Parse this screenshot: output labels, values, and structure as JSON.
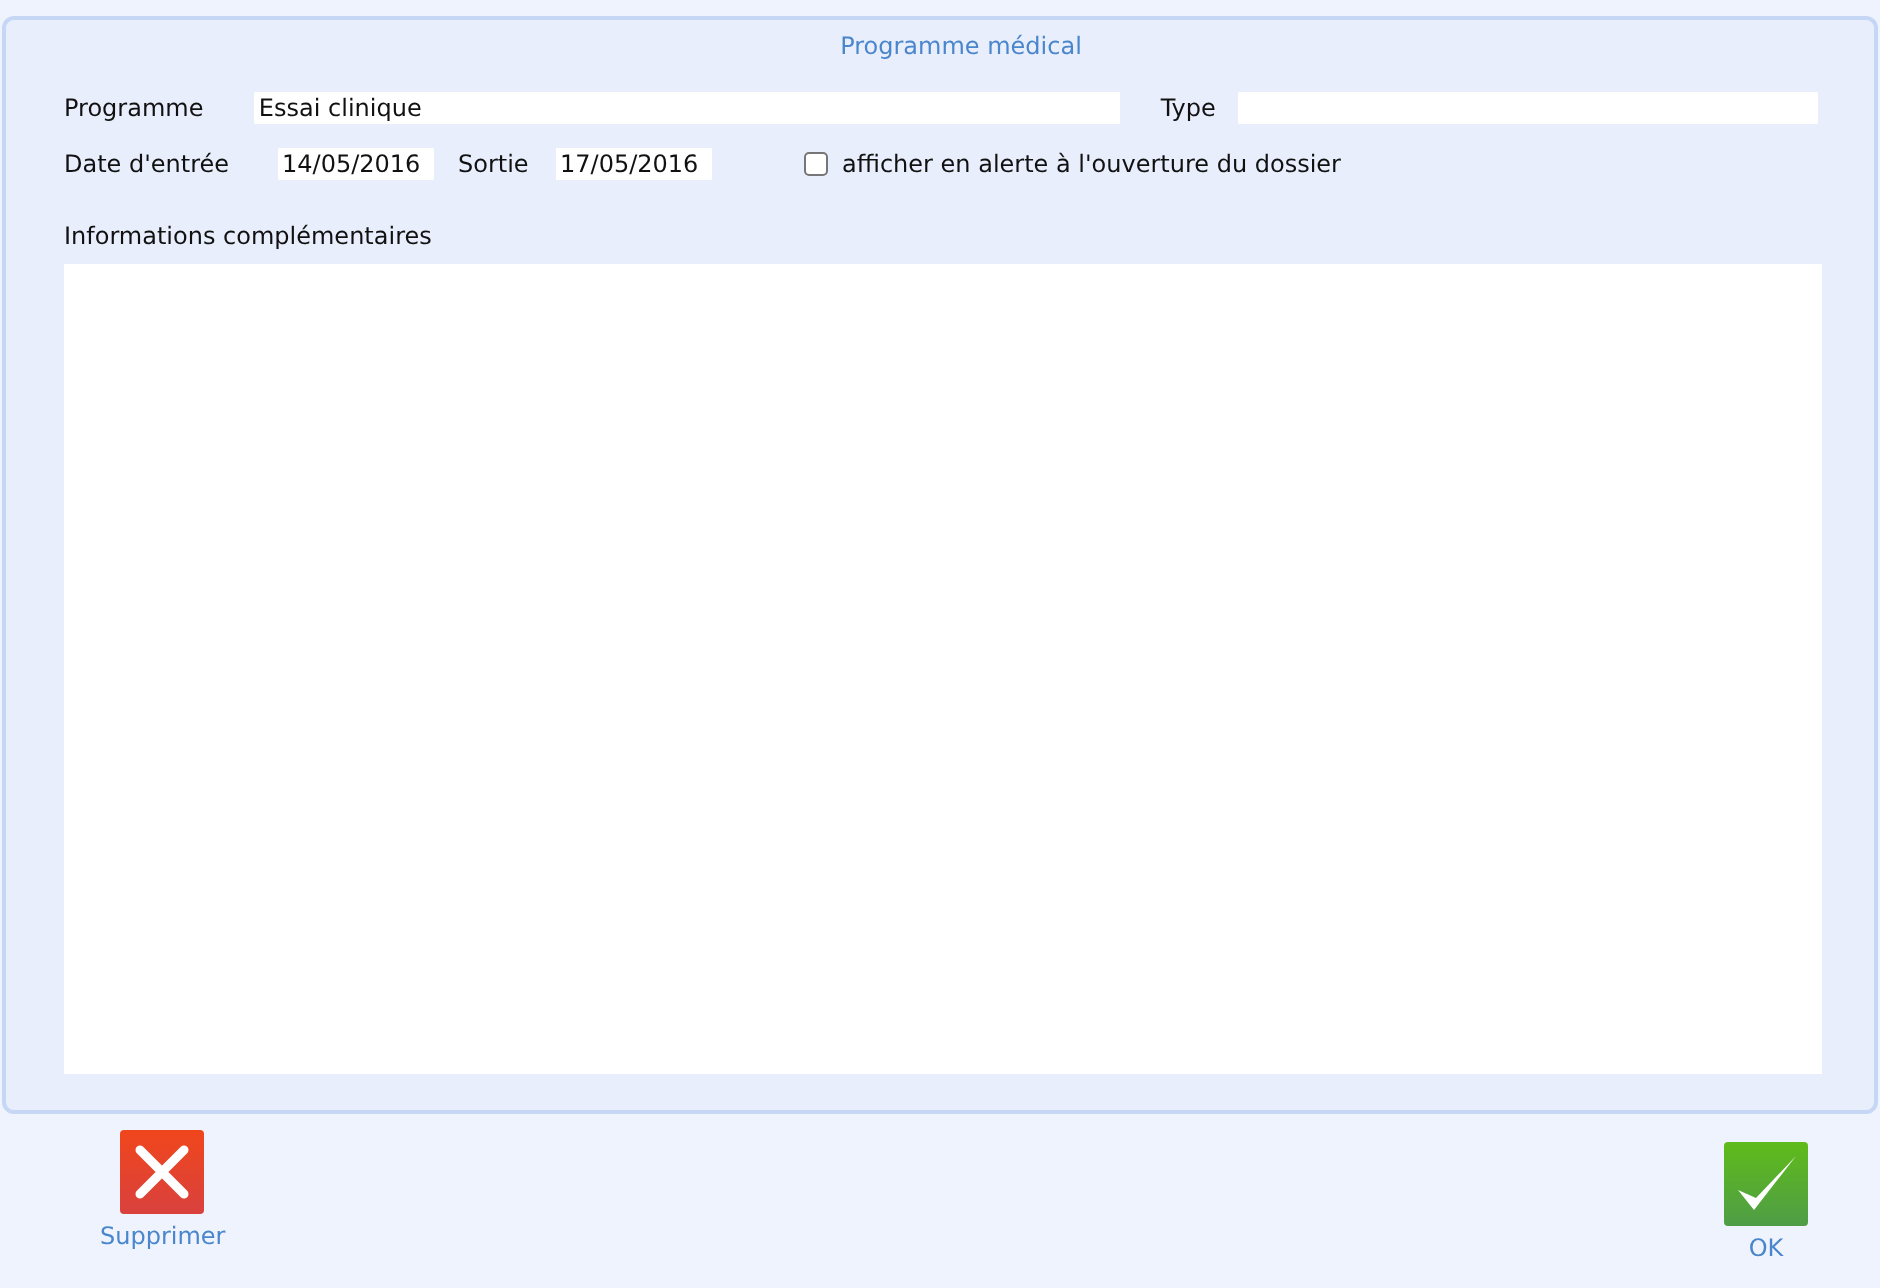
{
  "panel": {
    "title": "Programme médical"
  },
  "programme": {
    "label": "Programme",
    "value": "Essai clinique"
  },
  "type": {
    "label": "Type"
  },
  "entry_date": {
    "label": "Date d'entrée",
    "value": "14/05/2016"
  },
  "exit_date": {
    "label": "Sortie",
    "value": "17/05/2016"
  },
  "alert_checkbox": {
    "label": "afficher en alerte à l'ouverture du dossier",
    "checked": false
  },
  "notes": {
    "label": "Informations complémentaires"
  },
  "buttons": [
    {
      "kind": "delete",
      "label": "Supprimer"
    },
    {
      "kind": "ok",
      "label": "OK"
    }
  ]
}
